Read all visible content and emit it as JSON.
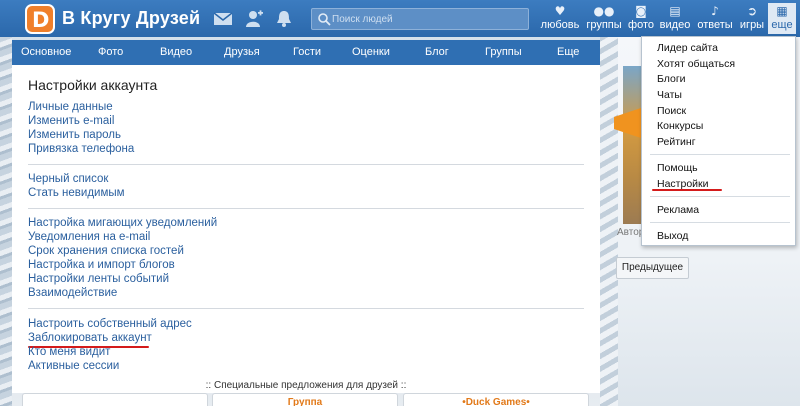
{
  "header": {
    "logo_text": "В Кругу Друзей",
    "logo_glyph": "D",
    "search_placeholder": "Поиск людей",
    "nav": [
      {
        "label": "любовь",
        "icon": "heart-icon"
      },
      {
        "label": "группы",
        "icon": "group-icon"
      },
      {
        "label": "фото",
        "icon": "camera-icon"
      },
      {
        "label": "видео",
        "icon": "film-icon"
      },
      {
        "label": "ответы",
        "icon": "answers-icon"
      },
      {
        "label": "игры",
        "icon": "games-icon"
      },
      {
        "label": "еще",
        "icon": "grid-icon"
      }
    ]
  },
  "menubar": [
    "Основное",
    "Фото",
    "Видео",
    "Друзья",
    "Гости",
    "Оценки",
    "Блог",
    "Группы",
    "Еще"
  ],
  "settings": {
    "title": "Настройки аккаунта",
    "group1": [
      "Личные данные",
      "Изменить e-mail",
      "Изменить пароль",
      "Привязка телефона"
    ],
    "group2": [
      "Черный список",
      "Стать невидимым"
    ],
    "group3": [
      "Настройка мигающих уведомлений",
      "Уведомления на e-mail",
      "Срок хранения списка гостей",
      "Настройка и импорт блогов",
      "Настройки ленты событий",
      "Взаимодействие"
    ],
    "group4": [
      "Настроить собственный адрес",
      "Заблокировать аккаунт",
      "Кто меня видит",
      "Активные сессии"
    ]
  },
  "special_offers": ":: Специальные предложения для друзей ::",
  "offer_boxes": [
    "",
    "Группа",
    "•Duck Games•"
  ],
  "right_column": {
    "caption": "Автор",
    "prev_button": "Предыдущее"
  },
  "dropdown": {
    "group1": [
      "Лидер сайта",
      "Хотят общаться",
      "Блоги",
      "Чаты",
      "Поиск",
      "Конкурсы",
      "Рейтинг"
    ],
    "group2": [
      "Помощь",
      "Настройки"
    ],
    "group3": [
      "Реклама"
    ],
    "group4": [
      "Выход"
    ]
  },
  "colors": {
    "topbar": "#2b68ab",
    "menubar": "#2f6fb3",
    "link": "#2a5f9e",
    "highlight_underline": "#d41b1b",
    "logo": "#f07f2a"
  }
}
